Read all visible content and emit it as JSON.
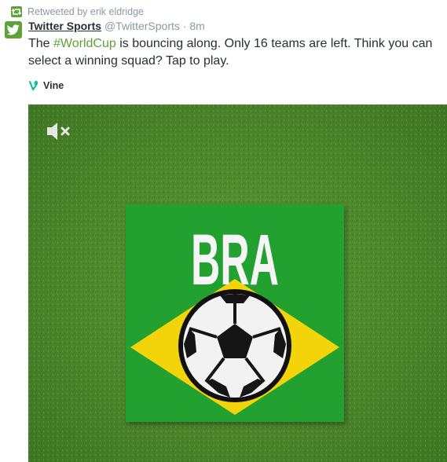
{
  "retweet": {
    "label": "Retweeted by erik eldridge"
  },
  "author": {
    "display_name": "Twitter Sports",
    "handle": "@TwitterSports",
    "separator": "·",
    "time": "8m"
  },
  "tweet": {
    "text_before": "The ",
    "hashtag": "#WorldCup",
    "text_after": " is bouncing along. Only 16 teams are left. Think you can select a winning squad? Tap to play."
  },
  "card": {
    "source": "Vine"
  },
  "media": {
    "flag_text": "BRA",
    "mute_icon": "speaker-muted-icon"
  },
  "colors": {
    "accent_green": "#5ea33a",
    "brand_blue": "#ffffff",
    "muted_text": "#8899a6",
    "body_text": "#292f33",
    "flag_green": "#22a130",
    "flag_yellow": "#f3d40b"
  }
}
